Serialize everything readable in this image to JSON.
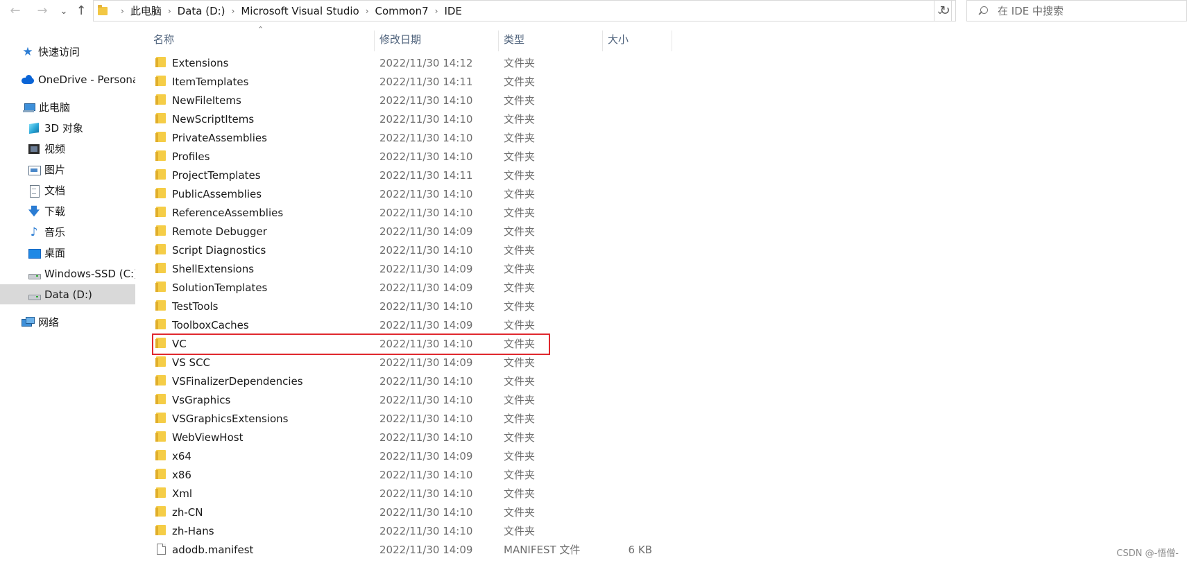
{
  "nav": {
    "back_icon": "back-arrow-icon",
    "forward_icon": "forward-arrow-icon",
    "recent_icon": "chevron-down-icon",
    "up_icon": "up-arrow-icon"
  },
  "breadcrumb": [
    "此电脑",
    "Data (D:)",
    "Microsoft Visual Studio",
    "Common7",
    "IDE"
  ],
  "search": {
    "placeholder": "在 IDE 中搜索"
  },
  "sidebar": [
    {
      "label": "快速访问",
      "icon": "quick-access-star-icon"
    },
    {
      "label": "OneDrive - Persona",
      "icon": "onedrive-cloud-icon"
    },
    {
      "label": "此电脑",
      "icon": "this-pc-icon"
    },
    {
      "label": "3D 对象",
      "icon": "3d-objects-icon"
    },
    {
      "label": "视频",
      "icon": "videos-icon"
    },
    {
      "label": "图片",
      "icon": "pictures-icon"
    },
    {
      "label": "文档",
      "icon": "documents-icon"
    },
    {
      "label": "下载",
      "icon": "downloads-icon"
    },
    {
      "label": "音乐",
      "icon": "music-icon"
    },
    {
      "label": "桌面",
      "icon": "desktop-icon"
    },
    {
      "label": "Windows-SSD (C:)",
      "icon": "windows-drive-icon"
    },
    {
      "label": "Data (D:)",
      "icon": "drive-icon",
      "selected": true
    },
    {
      "label": "网络",
      "icon": "network-icon"
    }
  ],
  "columns": {
    "name": "名称",
    "date": "修改日期",
    "type": "类型",
    "size": "大小"
  },
  "files": [
    {
      "name": "Extensions",
      "date": "2022/11/30 14:12",
      "type": "文件夹",
      "size": ""
    },
    {
      "name": "ItemTemplates",
      "date": "2022/11/30 14:11",
      "type": "文件夹",
      "size": ""
    },
    {
      "name": "NewFileItems",
      "date": "2022/11/30 14:10",
      "type": "文件夹",
      "size": ""
    },
    {
      "name": "NewScriptItems",
      "date": "2022/11/30 14:10",
      "type": "文件夹",
      "size": ""
    },
    {
      "name": "PrivateAssemblies",
      "date": "2022/11/30 14:10",
      "type": "文件夹",
      "size": ""
    },
    {
      "name": "Profiles",
      "date": "2022/11/30 14:10",
      "type": "文件夹",
      "size": ""
    },
    {
      "name": "ProjectTemplates",
      "date": "2022/11/30 14:11",
      "type": "文件夹",
      "size": ""
    },
    {
      "name": "PublicAssemblies",
      "date": "2022/11/30 14:10",
      "type": "文件夹",
      "size": ""
    },
    {
      "name": "ReferenceAssemblies",
      "date": "2022/11/30 14:10",
      "type": "文件夹",
      "size": ""
    },
    {
      "name": "Remote Debugger",
      "date": "2022/11/30 14:09",
      "type": "文件夹",
      "size": ""
    },
    {
      "name": "Script Diagnostics",
      "date": "2022/11/30 14:10",
      "type": "文件夹",
      "size": ""
    },
    {
      "name": "ShellExtensions",
      "date": "2022/11/30 14:09",
      "type": "文件夹",
      "size": ""
    },
    {
      "name": "SolutionTemplates",
      "date": "2022/11/30 14:09",
      "type": "文件夹",
      "size": ""
    },
    {
      "name": "TestTools",
      "date": "2022/11/30 14:10",
      "type": "文件夹",
      "size": ""
    },
    {
      "name": "ToolboxCaches",
      "date": "2022/11/30 14:09",
      "type": "文件夹",
      "size": ""
    },
    {
      "name": "VC",
      "date": "2022/11/30 14:10",
      "type": "文件夹",
      "size": "",
      "highlighted": true
    },
    {
      "name": "VS SCC",
      "date": "2022/11/30 14:09",
      "type": "文件夹",
      "size": ""
    },
    {
      "name": "VSFinalizerDependencies",
      "date": "2022/11/30 14:10",
      "type": "文件夹",
      "size": ""
    },
    {
      "name": "VsGraphics",
      "date": "2022/11/30 14:10",
      "type": "文件夹",
      "size": ""
    },
    {
      "name": "VSGraphicsExtensions",
      "date": "2022/11/30 14:10",
      "type": "文件夹",
      "size": ""
    },
    {
      "name": "WebViewHost",
      "date": "2022/11/30 14:10",
      "type": "文件夹",
      "size": ""
    },
    {
      "name": "x64",
      "date": "2022/11/30 14:09",
      "type": "文件夹",
      "size": ""
    },
    {
      "name": "x86",
      "date": "2022/11/30 14:10",
      "type": "文件夹",
      "size": ""
    },
    {
      "name": "Xml",
      "date": "2022/11/30 14:10",
      "type": "文件夹",
      "size": ""
    },
    {
      "name": "zh-CN",
      "date": "2022/11/30 14:10",
      "type": "文件夹",
      "size": ""
    },
    {
      "name": "zh-Hans",
      "date": "2022/11/30 14:10",
      "type": "文件夹",
      "size": ""
    },
    {
      "name": "adodb.manifest",
      "date": "2022/11/30 14:09",
      "type": "MANIFEST 文件",
      "size": "6 KB",
      "kind": "file"
    }
  ],
  "colors": {
    "highlight_border": "#e0282e",
    "selected_bg": "#d9d9d9",
    "folder": "#f5cd47"
  },
  "watermark": "CSDN @-悟僧-"
}
